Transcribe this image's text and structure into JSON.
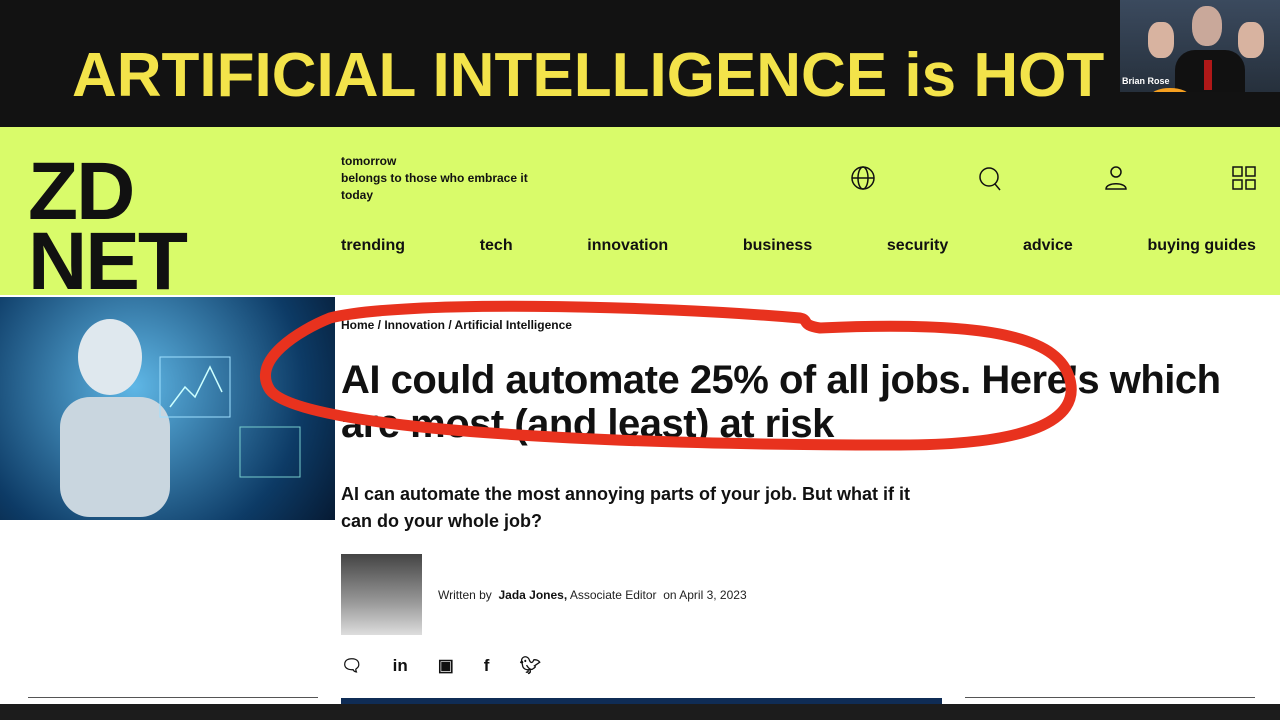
{
  "banner": {
    "title": "ARTIFICIAL INTELLIGENCE is HOT"
  },
  "video": {
    "participant_name": "Brian Rose"
  },
  "site": {
    "logo": "ZD NET",
    "logo_line1": "ZD",
    "logo_line2": "NET",
    "tagline": [
      "tomorrow",
      "belongs to those who embrace it",
      "today"
    ],
    "icons": [
      "globe-icon",
      "search-icon",
      "user-icon",
      "grid-menu-icon"
    ],
    "nav": [
      "trending",
      "tech",
      "innovation",
      "business",
      "security",
      "advice",
      "buying guides"
    ],
    "accent": "#d9fb6a"
  },
  "article": {
    "breadcrumb": "Home / Innovation / Artificial Intelligence",
    "headline": "AI could automate 25% of all jobs. Here's which are most (and least) at risk",
    "dek": "AI can automate the most annoying parts of your job. But what if it can do your whole job?",
    "byline": {
      "prefix": "Written by",
      "author": "Jada Jones,",
      "role": "Associate Editor",
      "date": "on April 3, 2023"
    },
    "share": [
      "comment-icon",
      "linkedin-icon",
      "flipboard-icon",
      "facebook-icon",
      "twitter-icon"
    ]
  },
  "annotation_color": "#e8321e"
}
